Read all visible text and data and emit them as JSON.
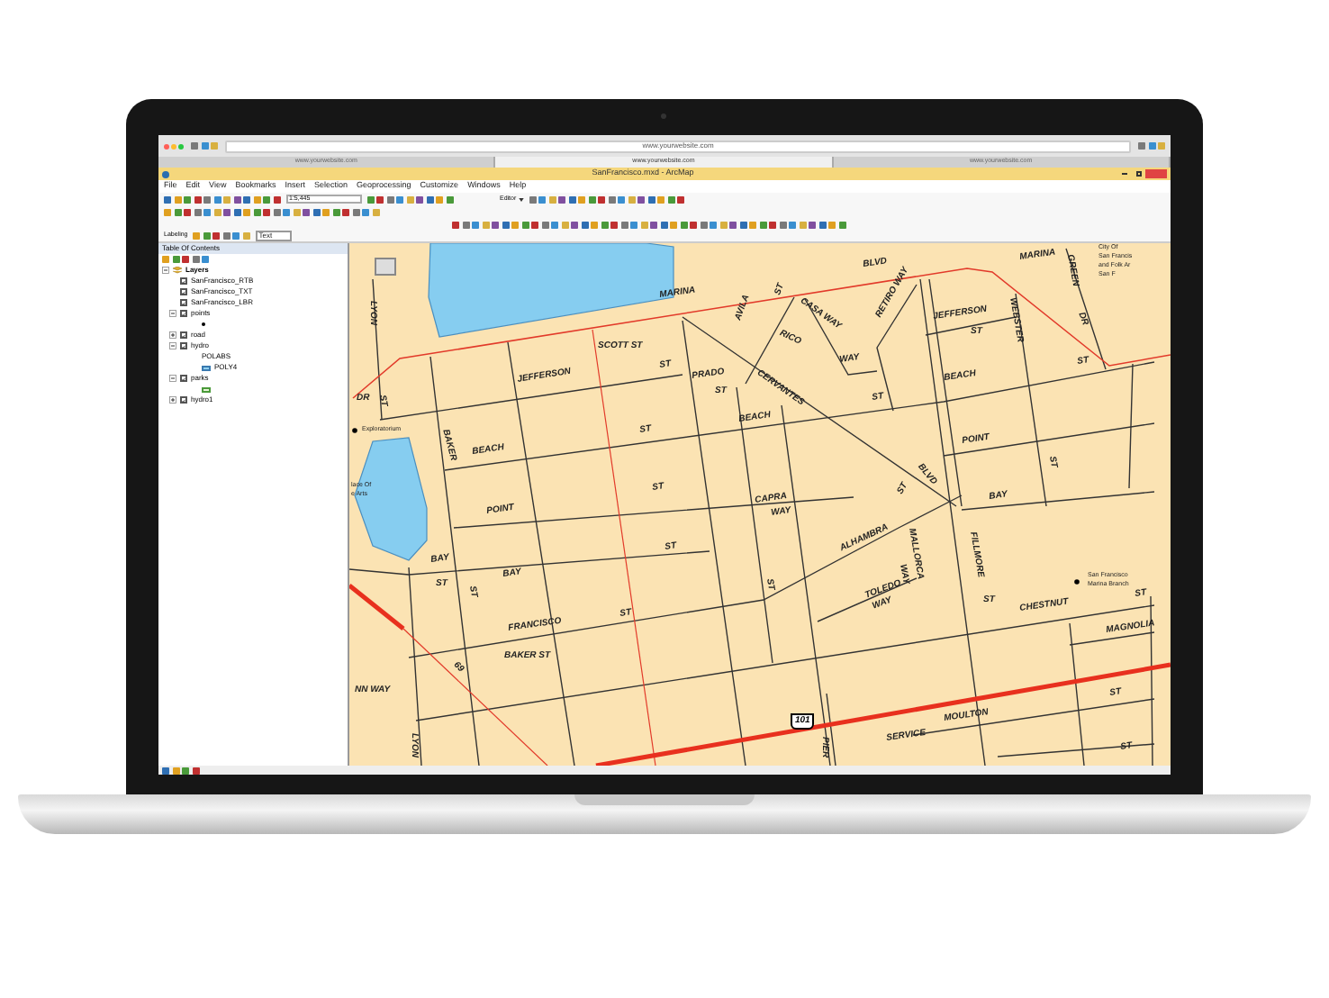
{
  "browser": {
    "tabs": [
      {
        "label": "www.yourwebsite.com",
        "selected": false
      },
      {
        "label": "www.yourwebsite.com",
        "selected": true
      },
      {
        "label": "www.yourwebsite.com",
        "selected": false
      }
    ],
    "url": "www.yourwebsite.com"
  },
  "window": {
    "title": "SanFrancisco.mxd - ArcMap"
  },
  "menu": [
    "File",
    "Edit",
    "View",
    "Bookmarks",
    "Insert",
    "Selection",
    "Geoprocessing",
    "Customize",
    "Windows",
    "Help"
  ],
  "toolbar": {
    "scale": "1:5,445",
    "editor": "Editor"
  },
  "labeling_toolbar": {
    "label": "Labeling",
    "style": "Text"
  },
  "toc": {
    "title": "Table Of Contents",
    "root": {
      "name": "Layers",
      "expanded": true,
      "children": [
        {
          "name": "SanFrancisco_RTB",
          "kind": "annotation",
          "checked": true
        },
        {
          "name": "SanFrancisco_TXT",
          "kind": "annotation",
          "checked": true
        },
        {
          "name": "SanFrancisco_LBR",
          "kind": "annotation",
          "checked": true
        },
        {
          "name": "points",
          "kind": "layer",
          "checked": true,
          "expanded": true,
          "legend": [
            {
              "kind": "dot"
            }
          ]
        },
        {
          "name": "road",
          "kind": "layer",
          "checked": true,
          "expanded": false
        },
        {
          "name": "hydro",
          "kind": "layer",
          "checked": true,
          "expanded": true,
          "legend": [
            {
              "label": "POLABS"
            },
            {
              "label": "POLY4",
              "kind": "fill"
            }
          ]
        },
        {
          "name": "parks",
          "kind": "layer",
          "checked": true,
          "expanded": true,
          "legend": [
            {
              "kind": "outline"
            }
          ]
        },
        {
          "name": "hydro1",
          "kind": "layer",
          "checked": true,
          "expanded": false
        }
      ]
    }
  },
  "map": {
    "labels": [
      {
        "text": "MARINA",
        "kind": "street"
      },
      {
        "text": "BLVD",
        "kind": "street"
      },
      {
        "text": "SCOTT ST",
        "kind": "street"
      },
      {
        "text": "JEFFERSON",
        "kind": "street"
      },
      {
        "text": "ST",
        "kind": "street"
      },
      {
        "text": "PRADO",
        "kind": "street"
      },
      {
        "text": "ST",
        "kind": "street"
      },
      {
        "text": "CERVANTES",
        "kind": "street"
      },
      {
        "text": "AVILA",
        "kind": "street"
      },
      {
        "text": "ST",
        "kind": "street"
      },
      {
        "text": "RICO",
        "kind": "street"
      },
      {
        "text": "CASA WAY",
        "kind": "street"
      },
      {
        "text": "RETIRO WAY",
        "kind": "street"
      },
      {
        "text": "WAY",
        "kind": "street"
      },
      {
        "text": "ST",
        "kind": "street"
      },
      {
        "text": "JEFFERSON",
        "kind": "street"
      },
      {
        "text": "ST",
        "kind": "street"
      },
      {
        "text": "WEBSTER",
        "kind": "street"
      },
      {
        "text": "MARINA",
        "kind": "street"
      },
      {
        "text": "GREEN",
        "kind": "street"
      },
      {
        "text": "DR",
        "kind": "street"
      },
      {
        "text": "City Of",
        "kind": "place"
      },
      {
        "text": "San Francis",
        "kind": "place"
      },
      {
        "text": "and Folk Ar",
        "kind": "place"
      },
      {
        "text": "San F",
        "kind": "place"
      },
      {
        "text": "ST",
        "kind": "street"
      },
      {
        "text": "BEACH",
        "kind": "street"
      },
      {
        "text": "BEACH",
        "kind": "street"
      },
      {
        "text": "ST",
        "kind": "street"
      },
      {
        "text": "POINT",
        "kind": "street"
      },
      {
        "text": "ST",
        "kind": "street"
      },
      {
        "text": "BAY",
        "kind": "street"
      },
      {
        "text": "BLVD",
        "kind": "street"
      },
      {
        "text": "ST",
        "kind": "street"
      },
      {
        "text": "CAPRA",
        "kind": "street"
      },
      {
        "text": "WAY",
        "kind": "street"
      },
      {
        "text": "ST",
        "kind": "street"
      },
      {
        "text": "BEACH",
        "kind": "street"
      },
      {
        "text": "BAKER",
        "kind": "street"
      },
      {
        "text": "Exploratorium",
        "kind": "place"
      },
      {
        "text": "LYON",
        "kind": "street"
      },
      {
        "text": "DR",
        "kind": "street"
      },
      {
        "text": "ST",
        "kind": "street"
      },
      {
        "text": "lace Of",
        "kind": "place"
      },
      {
        "text": "e Arts",
        "kind": "place"
      },
      {
        "text": "POINT",
        "kind": "street"
      },
      {
        "text": "ST",
        "kind": "street"
      },
      {
        "text": "BAY",
        "kind": "street"
      },
      {
        "text": "ST",
        "kind": "street"
      },
      {
        "text": "BAY",
        "kind": "street"
      },
      {
        "text": "ST",
        "kind": "street"
      },
      {
        "text": "ALHAMBRA",
        "kind": "street"
      },
      {
        "text": "MALLORCA",
        "kind": "street"
      },
      {
        "text": "WAY",
        "kind": "street"
      },
      {
        "text": "FILLMORE",
        "kind": "street"
      },
      {
        "text": "ST",
        "kind": "street"
      },
      {
        "text": "TOLEDO",
        "kind": "street"
      },
      {
        "text": "WAY",
        "kind": "street"
      },
      {
        "text": "ST",
        "kind": "street"
      },
      {
        "text": "CHESTNUT",
        "kind": "street"
      },
      {
        "text": "San Francisco",
        "kind": "place"
      },
      {
        "text": "Marina Branch",
        "kind": "place"
      },
      {
        "text": "ST",
        "kind": "street"
      },
      {
        "text": "MAGNOLIA",
        "kind": "street"
      },
      {
        "text": "FRANCISCO",
        "kind": "street"
      },
      {
        "text": "ST",
        "kind": "street"
      },
      {
        "text": "BAKER ST",
        "kind": "street"
      },
      {
        "text": "69",
        "kind": "street"
      },
      {
        "text": "NN WAY",
        "kind": "street"
      },
      {
        "text": "LYON",
        "kind": "street"
      },
      {
        "text": "101",
        "kind": "shield"
      },
      {
        "text": "PIER",
        "kind": "street"
      },
      {
        "text": "MOULTON",
        "kind": "street"
      },
      {
        "text": "SERVICE",
        "kind": "street"
      },
      {
        "text": "ST",
        "kind": "street"
      },
      {
        "text": "ST",
        "kind": "street"
      }
    ]
  }
}
